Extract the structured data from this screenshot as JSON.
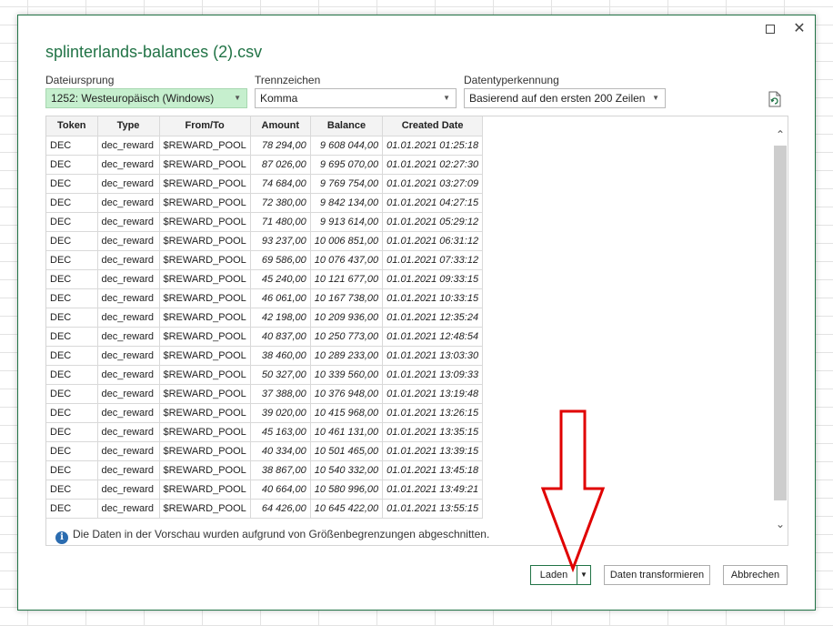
{
  "dialog": {
    "title": "splinterlands-balances (2).csv",
    "maximize_glyph": "",
    "close_glyph": "✕"
  },
  "options": {
    "origin_label": "Dateiursprung",
    "origin_value": "1252: Westeuropäisch (Windows)",
    "delimiter_label": "Trennzeichen",
    "delimiter_value": "Komma",
    "detection_label": "Datentyperkennung",
    "detection_value": "Basierend auf den ersten 200 Zeilen"
  },
  "table": {
    "headers": [
      "Token",
      "Type",
      "From/To",
      "Amount",
      "Balance",
      "Created Date"
    ],
    "rows": [
      [
        "DEC",
        "dec_reward",
        "$REWARD_POOL",
        "78 294,00",
        "9 608 044,00",
        "01.01.2021 01:25:18"
      ],
      [
        "DEC",
        "dec_reward",
        "$REWARD_POOL",
        "87 026,00",
        "9 695 070,00",
        "01.01.2021 02:27:30"
      ],
      [
        "DEC",
        "dec_reward",
        "$REWARD_POOL",
        "74 684,00",
        "9 769 754,00",
        "01.01.2021 03:27:09"
      ],
      [
        "DEC",
        "dec_reward",
        "$REWARD_POOL",
        "72 380,00",
        "9 842 134,00",
        "01.01.2021 04:27:15"
      ],
      [
        "DEC",
        "dec_reward",
        "$REWARD_POOL",
        "71 480,00",
        "9 913 614,00",
        "01.01.2021 05:29:12"
      ],
      [
        "DEC",
        "dec_reward",
        "$REWARD_POOL",
        "93 237,00",
        "10 006 851,00",
        "01.01.2021 06:31:12"
      ],
      [
        "DEC",
        "dec_reward",
        "$REWARD_POOL",
        "69 586,00",
        "10 076 437,00",
        "01.01.2021 07:33:12"
      ],
      [
        "DEC",
        "dec_reward",
        "$REWARD_POOL",
        "45 240,00",
        "10 121 677,00",
        "01.01.2021 09:33:15"
      ],
      [
        "DEC",
        "dec_reward",
        "$REWARD_POOL",
        "46 061,00",
        "10 167 738,00",
        "01.01.2021 10:33:15"
      ],
      [
        "DEC",
        "dec_reward",
        "$REWARD_POOL",
        "42 198,00",
        "10 209 936,00",
        "01.01.2021 12:35:24"
      ],
      [
        "DEC",
        "dec_reward",
        "$REWARD_POOL",
        "40 837,00",
        "10 250 773,00",
        "01.01.2021 12:48:54"
      ],
      [
        "DEC",
        "dec_reward",
        "$REWARD_POOL",
        "38 460,00",
        "10 289 233,00",
        "01.01.2021 13:03:30"
      ],
      [
        "DEC",
        "dec_reward",
        "$REWARD_POOL",
        "50 327,00",
        "10 339 560,00",
        "01.01.2021 13:09:33"
      ],
      [
        "DEC",
        "dec_reward",
        "$REWARD_POOL",
        "37 388,00",
        "10 376 948,00",
        "01.01.2021 13:19:48"
      ],
      [
        "DEC",
        "dec_reward",
        "$REWARD_POOL",
        "39 020,00",
        "10 415 968,00",
        "01.01.2021 13:26:15"
      ],
      [
        "DEC",
        "dec_reward",
        "$REWARD_POOL",
        "45 163,00",
        "10 461 131,00",
        "01.01.2021 13:35:15"
      ],
      [
        "DEC",
        "dec_reward",
        "$REWARD_POOL",
        "40 334,00",
        "10 501 465,00",
        "01.01.2021 13:39:15"
      ],
      [
        "DEC",
        "dec_reward",
        "$REWARD_POOL",
        "38 867,00",
        "10 540 332,00",
        "01.01.2021 13:45:18"
      ],
      [
        "DEC",
        "dec_reward",
        "$REWARD_POOL",
        "40 664,00",
        "10 580 996,00",
        "01.01.2021 13:49:21"
      ],
      [
        "DEC",
        "dec_reward",
        "$REWARD_POOL",
        "64 426,00",
        "10 645 422,00",
        "01.01.2021 13:55:15"
      ]
    ]
  },
  "note": {
    "text": "Die Daten in der Vorschau wurden aufgrund von Größenbegrenzungen abgeschnitten."
  },
  "buttons": {
    "load_label": "Laden",
    "transform_label": "Daten transformieren",
    "cancel_label": "Abbrechen"
  },
  "colors": {
    "accent": "#217346",
    "selected_dropdown": "#c6efce",
    "annotation_arrow": "#e00000",
    "info_icon": "#2b6cb0"
  },
  "icons": {
    "refresh": "refresh-icon",
    "info": "info-icon",
    "maximize": "maximize-icon",
    "close": "close-icon"
  }
}
